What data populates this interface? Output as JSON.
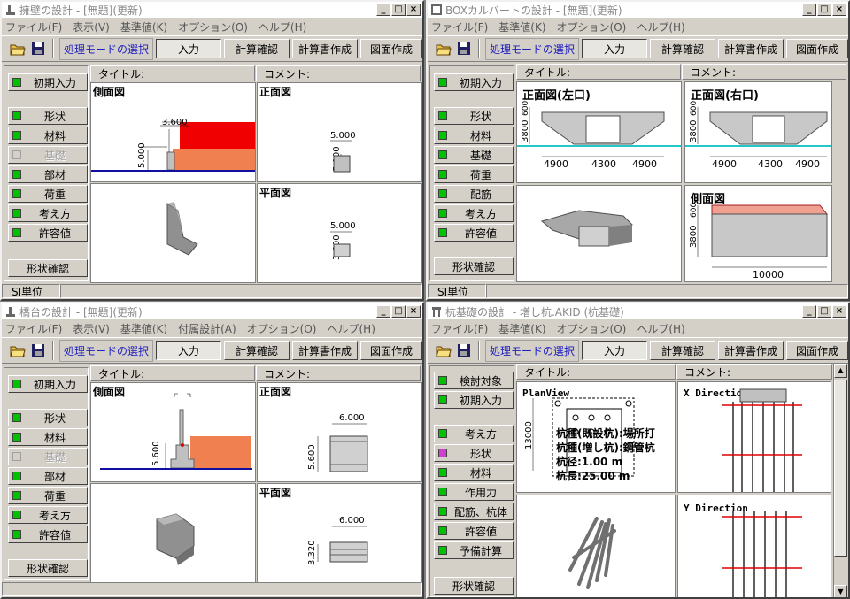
{
  "common": {
    "mode_label": "処理モードの選択",
    "modes": [
      "入力",
      "計算確認",
      "計算書作成",
      "図面作成"
    ],
    "title_header": "タイトル:",
    "comment_header": "コメント:",
    "shape_check": "形状確認",
    "status_units": "SI単位",
    "win_min": "_",
    "win_max": "□",
    "win_close": "×"
  },
  "win1": {
    "title": "擁壁の設計 - [無題](更新)",
    "menus": [
      "ファイル(F)",
      "表示(V)",
      "基準値(K)",
      "オプション(O)",
      "ヘルプ(H)"
    ],
    "side_top": "初期入力",
    "side_items": [
      "形状",
      "材料",
      "基礎",
      "部材",
      "荷重",
      "考え方",
      "許容値"
    ],
    "p_side": "側面図",
    "p_front": "正面図",
    "p_plan": "平面図",
    "dims": {
      "d1": "3.600",
      "d2": "5.000",
      "d3": "5.000",
      "d4": "5.000",
      "d5": "5.000",
      "d6": "3.600"
    }
  },
  "win2": {
    "title": "BOXカルバートの設計 - [無題](更新)",
    "menus": [
      "ファイル(F)",
      "基準値(K)",
      "オプション(O)",
      "ヘルプ(H)"
    ],
    "side_top": "初期入力",
    "side_items": [
      "形状",
      "材料",
      "基礎",
      "荷重",
      "配筋",
      "考え方",
      "許容値"
    ],
    "p_left": "正面図(左口)",
    "p_right": "正面図(右口)",
    "p_side": "側面図",
    "dims": {
      "h": "3800",
      "h2": "600",
      "a": "4900",
      "b": "4300",
      "c": "4900",
      "len": "10000"
    }
  },
  "win3": {
    "title": "橋台の設計 - [無題](更新)",
    "menus": [
      "ファイル(F)",
      "表示(V)",
      "基準値(K)",
      "付属設計(A)",
      "オプション(O)",
      "ヘルプ(H)"
    ],
    "side_top": "初期入力",
    "side_items": [
      "形状",
      "材料",
      "基礎",
      "部材",
      "荷重",
      "考え方",
      "許容値"
    ],
    "p_side": "側面図",
    "p_front": "正面図",
    "p_plan": "平面図",
    "dims": {
      "s1": "5.600",
      "f1": "6.000",
      "f2": "5.600",
      "pl1": "6.000",
      "pl2": "3.320"
    }
  },
  "win4": {
    "title": "杭基礎の設計 - 増し杭.AKID (杭基礎)",
    "menus": [
      "ファイル(F)",
      "基準値(K)",
      "オプション(O)",
      "ヘルプ(H)"
    ],
    "side_top": [
      "検討対象",
      "初期入力"
    ],
    "side_items": [
      "考え方",
      "形状",
      "材料",
      "作用力",
      "配筋、杭体",
      "許容値",
      "予備計算"
    ],
    "plan_label": "PlanView",
    "x_label": "X Direction",
    "y_label": "Y Direction",
    "plan_dim": "13000",
    "plan_text": [
      "杭種(既設杭):場所打",
      "杭種(増し杭):鋼管杭",
      "杭径:1.00 m",
      "杭長:25.00 m"
    ]
  }
}
